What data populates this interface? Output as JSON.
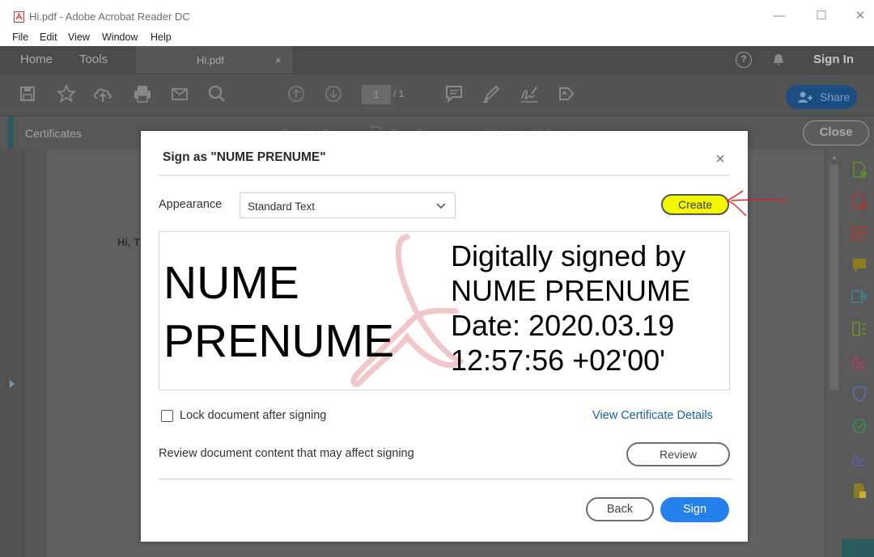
{
  "window": {
    "title": "Hi.pdf - Adobe Acrobat Reader DC",
    "minimize": "—",
    "maximize": "☐",
    "close": "✕"
  },
  "menu": [
    "File",
    "Edit",
    "View",
    "Window",
    "Help"
  ],
  "tabs": {
    "home": "Home",
    "tools": "Tools",
    "document": "Hi.pdf",
    "document_close": "×",
    "help": "?",
    "sign_in": "Sign In"
  },
  "toolbar": {
    "page_current": "1",
    "page_total": "/ 1",
    "share": "Share"
  },
  "certificates_bar": {
    "label": "Certificates",
    "digitally_sign": "Digitally Sign",
    "time_stamp": "Time Stamp",
    "validate_all": "Validate All Signatures",
    "close": "Close"
  },
  "document": {
    "text": "Hi, T"
  },
  "dialog": {
    "title": "Sign as \"NUME PRENUME\"",
    "close": "×",
    "appearance_label": "Appearance",
    "appearance_value": "Standard Text",
    "create": "Create",
    "preview": {
      "name_line1": "NUME",
      "name_line2": "PRENUME",
      "detail_line1": "Digitally signed by",
      "detail_line2": "NUME PRENUME",
      "detail_line3": "Date: 2020.03.19",
      "detail_line4": "12:57:56 +02'00'"
    },
    "lock_label": "Lock document after signing",
    "lock_checked": false,
    "view_certificate": "View Certificate Details",
    "review_label": "Review document content that may affect signing",
    "review": "Review",
    "back": "Back",
    "sign": "Sign"
  },
  "colors": {
    "accent_blue": "#2680eb",
    "link_blue": "#1a5fa9",
    "highlight_yellow": "#f3f800",
    "annotation_red": "#e02020"
  }
}
